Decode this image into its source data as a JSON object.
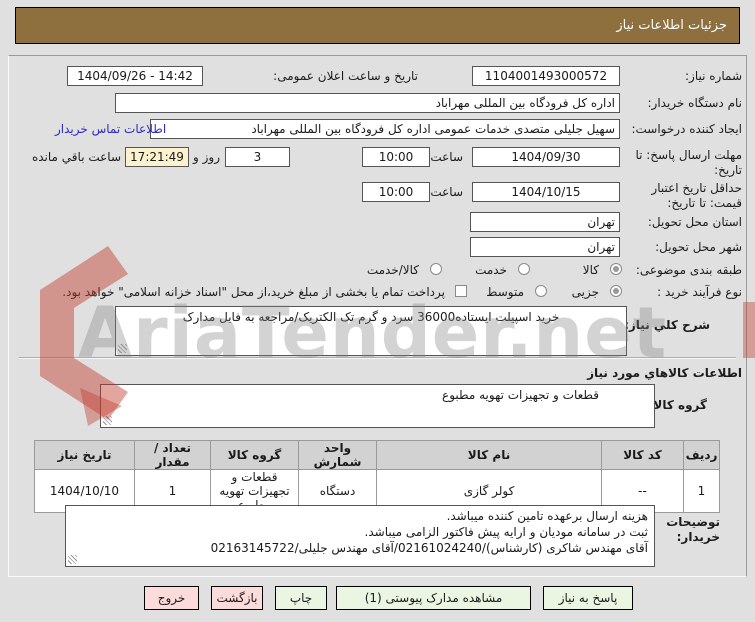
{
  "window": {
    "title": "جزئیات اطلاعات نیاز"
  },
  "form": {
    "need_number": {
      "label": "شماره نیاز:",
      "value": "1104001493000572"
    },
    "announce_datetime": {
      "label": "تاریخ و ساعت اعلان عمومی:",
      "value": "1404/09/26 - 14:42"
    },
    "buyer_org": {
      "label": "نام دستگاه خریدار:",
      "value": "اداره کل فرودگاه بین المللی مهراباد"
    },
    "request_creator": {
      "label": "ایجاد کننده درخواست:",
      "value": "سهیل جلیلی متصدی خدمات عمومی اداره کل فرودگاه بین المللی مهراباد"
    },
    "buyer_contact_link": "اطلاعات تماس خریدار",
    "reply_deadline": {
      "label": "مهلت ارسال پاسخ: تا تاریخ:",
      "date": "1404/09/30",
      "hour_label": "ساعت",
      "time": "10:00",
      "days_left": "3",
      "days_label": "روز و",
      "time_left": "17:21:49",
      "remaining_label": "ساعت باقي مانده"
    },
    "price_validity": {
      "label": "حداقل تاریخ اعتبار قیمت: تا تاریخ:",
      "date": "1404/10/15",
      "hour_label": "ساعت",
      "time": "10:00"
    },
    "province": {
      "label": "استان محل تحویل:",
      "value": "تهران"
    },
    "city": {
      "label": "شهر محل تحویل:",
      "value": "تهران"
    },
    "subject_class": {
      "label": "طبقه بندی موضوعی:",
      "options": [
        "کالا",
        "خدمت",
        "کالا/خدمت"
      ],
      "selected": "کالا"
    },
    "process_type": {
      "label": "نوع فرآیند خرید :",
      "options": [
        "جزیی",
        "متوسط"
      ],
      "selected": "جزیی",
      "treasury_note": "پرداخت تمام یا بخشی از مبلغ خرید،از محل \"اسناد خزانه اسلامی\" خواهد بود."
    }
  },
  "need_desc": {
    "label": "شرح کلي نیاز:",
    "value": "خرید اسپیلت ایستاده36000 سرد و گرم تک الکتریک/مراجعه به فایل مدارک"
  },
  "goods_section": {
    "title": "اطلاعات کالاهاي مورد نیاز",
    "group_label": "گروه کالا:",
    "group_value": "قطعات و تجهیزات تهویه مطبوع"
  },
  "table": {
    "headers": [
      "ردیف",
      "کد کالا",
      "نام کالا",
      "واحد شمارش",
      "گروه کالا",
      "تعداد / مقدار",
      "تاریخ نیاز"
    ],
    "rows": [
      [
        "1",
        "--",
        "کولر گازی",
        "دستگاه",
        "قطعات و تجهیزات تهویه مطبوع",
        "1",
        "1404/10/10"
      ]
    ]
  },
  "buyer_notes": {
    "label_line1": "توضیحات",
    "label_line2": "خریدار:",
    "lines": [
      "هزینه ارسال برعهده تامین کننده میباشد.",
      "ثبت در سامانه مودیان و ارایه پیش فاکتور الزامی میباشد.",
      "آقای مهندس شاکری (کارشناس)/02161024240/آقای مهندس جلیلی/02163145722"
    ]
  },
  "buttons": {
    "reply": "پاسخ به نیاز",
    "view_docs": "مشاهده مدارک پیوستی (1)",
    "print": "چاپ",
    "back": "بازگشت",
    "exit": "خروج"
  },
  "watermark": "AriaTender.net",
  "colors": {
    "header_bg": "#8e6f3e",
    "timer_bg": "#fbf3cd",
    "button_green": "#eaf6e2",
    "button_pink": "#fcdbdb",
    "link_blue": "#2a2ac8",
    "watermark_red": "#c0392b"
  }
}
